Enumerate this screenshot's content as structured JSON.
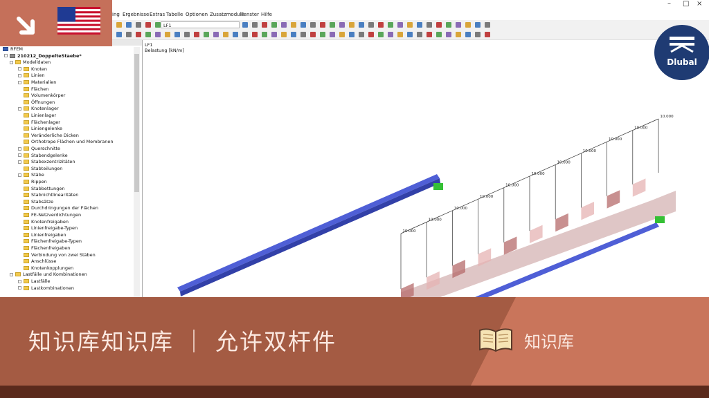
{
  "menu": {
    "items": [
      "ing",
      "Ergebnisse",
      "Extras",
      "Tabelle",
      "Optionen",
      "Zusatzmodule",
      "Fenster",
      "Hilfe"
    ]
  },
  "window_controls": {
    "minimize": "–",
    "maximize": "□",
    "close": "×"
  },
  "toolbar": {
    "load_case_value": "LF1"
  },
  "navigator": {
    "root": "RFEM",
    "project": "210212_DoppelteStaebe*",
    "items": [
      {
        "label": "Modelldaten",
        "level": 1,
        "expander": true
      },
      {
        "label": "Knoten",
        "level": 2,
        "expander": true
      },
      {
        "label": "Linien",
        "level": 2,
        "expander": true
      },
      {
        "label": "Materialien",
        "level": 2,
        "expander": true
      },
      {
        "label": "Flächen",
        "level": 2,
        "expander": false
      },
      {
        "label": "Volumenkörper",
        "level": 2,
        "expander": false
      },
      {
        "label": "Öffnungen",
        "level": 2,
        "expander": false
      },
      {
        "label": "Knotenlager",
        "level": 2,
        "expander": true
      },
      {
        "label": "Linienlager",
        "level": 2,
        "expander": false
      },
      {
        "label": "Flächenlager",
        "level": 2,
        "expander": false
      },
      {
        "label": "Liniengelenke",
        "level": 2,
        "expander": false
      },
      {
        "label": "Veränderliche Dicken",
        "level": 2,
        "expander": false
      },
      {
        "label": "Orthotrope Flächen und Membranen",
        "level": 2,
        "expander": false
      },
      {
        "label": "Querschnitte",
        "level": 2,
        "expander": true
      },
      {
        "label": "Stabendgelenke",
        "level": 2,
        "expander": true
      },
      {
        "label": "Stabexzentrizitäten",
        "level": 2,
        "expander": true
      },
      {
        "label": "Stabteilungen",
        "level": 2,
        "expander": false
      },
      {
        "label": "Stäbe",
        "level": 2,
        "expander": true
      },
      {
        "label": "Rippen",
        "level": 2,
        "expander": false
      },
      {
        "label": "Stabbettungen",
        "level": 2,
        "expander": false
      },
      {
        "label": "Stabnichtlinearitäten",
        "level": 2,
        "expander": false
      },
      {
        "label": "Stabsätze",
        "level": 2,
        "expander": false
      },
      {
        "label": "Durchdringungen der Flächen",
        "level": 2,
        "expander": false
      },
      {
        "label": "FE-Netzverdichtungen",
        "level": 2,
        "expander": false
      },
      {
        "label": "Knotenfreigaben",
        "level": 2,
        "expander": false
      },
      {
        "label": "Linienfreigabe-Typen",
        "level": 2,
        "expander": false
      },
      {
        "label": "Linienfreigaben",
        "level": 2,
        "expander": false
      },
      {
        "label": "Flächenfreigabe-Typen",
        "level": 2,
        "expander": false
      },
      {
        "label": "Flächenfreigaben",
        "level": 2,
        "expander": false
      },
      {
        "label": "Verbindung von zwei Stäben",
        "level": 2,
        "expander": false
      },
      {
        "label": "Anschlüsse",
        "level": 2,
        "expander": false
      },
      {
        "label": "Knotenkopplungen",
        "level": 2,
        "expander": false
      },
      {
        "label": "Lastfälle und Kombinationen",
        "level": 1,
        "expander": true
      },
      {
        "label": "Lastfälle",
        "level": 2,
        "expander": true
      },
      {
        "label": "Lastkombinationen",
        "level": 2,
        "expander": true
      }
    ]
  },
  "workspace": {
    "load_case": "LF1",
    "unit_label": "Belastung [kN/m]",
    "load_labels": [
      "10.000",
      "10.000",
      "10.000",
      "10.000",
      "10.000",
      "10.000",
      "10.000",
      "10.000",
      "10.000",
      "10.000",
      "10.000"
    ]
  },
  "badge": {
    "text": "Dlubal"
  },
  "banner": {
    "title": "知识库知识库 ｜ 允许双杆件",
    "label": "知识库"
  },
  "colors": {
    "banner": "#a45b43",
    "banner_light": "#c9755b",
    "bottom_strip": "#5b2a1c",
    "flag_tile": "#c5705a",
    "badge": "#1f3b73",
    "beam": "#4f5fd6",
    "support": "#35c035",
    "load_bar": "#b02828"
  },
  "icons": [
    "arrow-down-right-icon",
    "us-flag-icon",
    "dlubal-logo-icon",
    "open-book-icon"
  ]
}
